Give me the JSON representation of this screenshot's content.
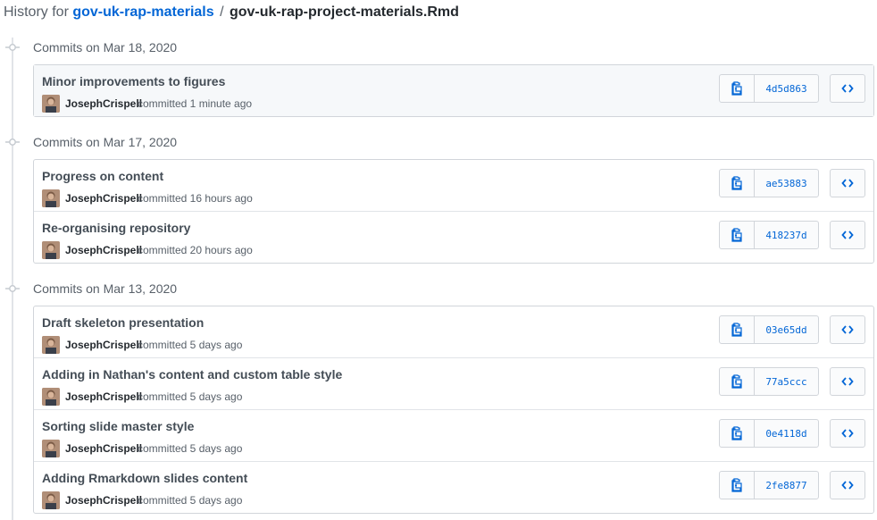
{
  "header": {
    "prefix": "History for",
    "repo": "gov-uk-rap-materials",
    "separator": "/",
    "file": "gov-uk-rap-project-materials.Rmd"
  },
  "icons": {
    "copy": "clippy-icon",
    "browse": "code-icon",
    "node": "git-commit-icon"
  },
  "colors": {
    "link": "#0366d6",
    "border": "#d1d5da",
    "highlight_row": "#f6f8fa"
  },
  "groups": [
    {
      "title": "Commits on Mar 18, 2020",
      "commits": [
        {
          "message": "Minor improvements to figures",
          "author": "JosephCrispell",
          "when": "committed 1 minute ago",
          "sha": "4d5d863"
        }
      ]
    },
    {
      "title": "Commits on Mar 17, 2020",
      "commits": [
        {
          "message": "Progress on content",
          "author": "JosephCrispell",
          "when": "committed 16 hours ago",
          "sha": "ae53883"
        },
        {
          "message": "Re-organising repository",
          "author": "JosephCrispell",
          "when": "committed 20 hours ago",
          "sha": "418237d"
        }
      ]
    },
    {
      "title": "Commits on Mar 13, 2020",
      "commits": [
        {
          "message": "Draft skeleton presentation",
          "author": "JosephCrispell",
          "when": "committed 5 days ago",
          "sha": "03e65dd"
        },
        {
          "message": "Adding in Nathan's content and custom table style",
          "author": "JosephCrispell",
          "when": "committed 5 days ago",
          "sha": "77a5ccc"
        },
        {
          "message": "Sorting slide master style",
          "author": "JosephCrispell",
          "when": "committed 5 days ago",
          "sha": "0e4118d"
        },
        {
          "message": "Adding Rmarkdown slides content",
          "author": "JosephCrispell",
          "when": "committed 5 days ago",
          "sha": "2fe8877"
        }
      ]
    }
  ]
}
